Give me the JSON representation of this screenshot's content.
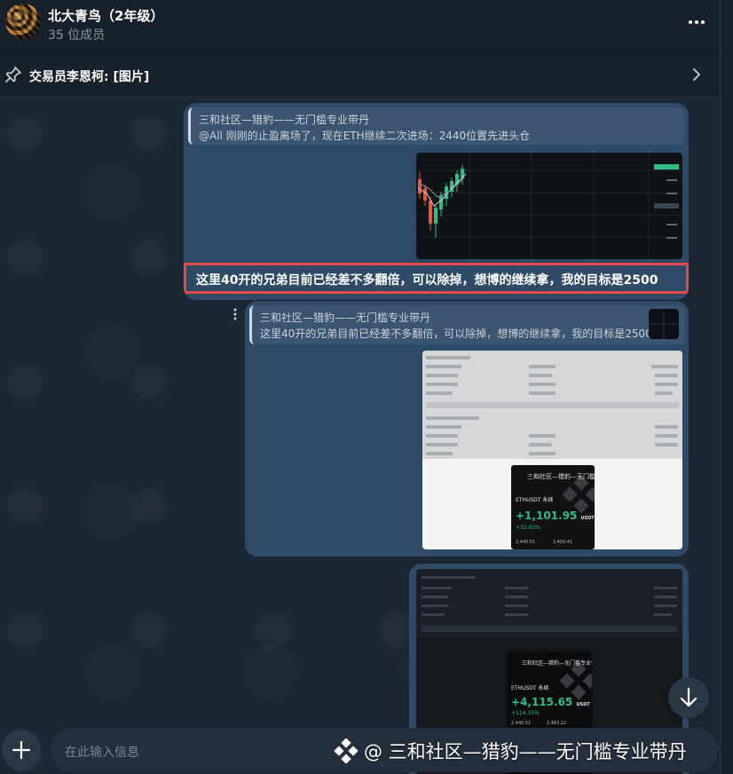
{
  "header": {
    "title": "北大青鸟（2年级）",
    "member_count": "35 位成员"
  },
  "pinned": {
    "text": "交易员李恩柯: [图片]"
  },
  "messages": {
    "m1": {
      "reply_name": "三和社区—猎豹——无门槛专业带丹",
      "reply_text": "@All 刚刚的止盈离场了，现在ETH继续二次进场：2440位置先进头仓",
      "body": "这里40开的兄弟目前已经差不多翻倍，可以除掉，想博的继续拿，我的目标是2500"
    },
    "m2": {
      "reply_name": "三和社区—猎豹——无门槛专业带丹",
      "reply_text": "这里40开的兄弟目前已经差不多翻倍，可以除掉，想博的继续拿，我的目标是2500",
      "card": {
        "title": "三和社区—猎豹—无门槛专业带丹",
        "pair": "ETHUSDT 永续",
        "pnl": "+1,101.95",
        "unit": "USDT",
        "pct": "+31.03%",
        "nums": "2,440.51 2,450.41"
      }
    },
    "m3": {
      "card": {
        "title": "三和社区—猎豹—无门槛专业带丹",
        "pair": "ETHUSDT 永续",
        "pnl": "+4,115.65",
        "unit": "USDT",
        "pct": "+114.35%",
        "nums": "2,440.51 2,483.22"
      }
    }
  },
  "composer": {
    "placeholder": "在此输入信息"
  },
  "watermark": {
    "text": "@ 三和社区—猎豹——无门槛专业带丹"
  },
  "colors": {
    "background": "#17212b",
    "bubble": "#2f4a66",
    "highlight_border": "#e34a4a",
    "profit": "#2ebd85"
  },
  "icons": {
    "more": "more-horizontal-icon",
    "pin": "pin-icon",
    "chevron": "chevron-right-icon",
    "scroll_down": "arrow-down-icon",
    "attach": "plus-icon",
    "watermark_logo": "diamond-logo-icon"
  }
}
